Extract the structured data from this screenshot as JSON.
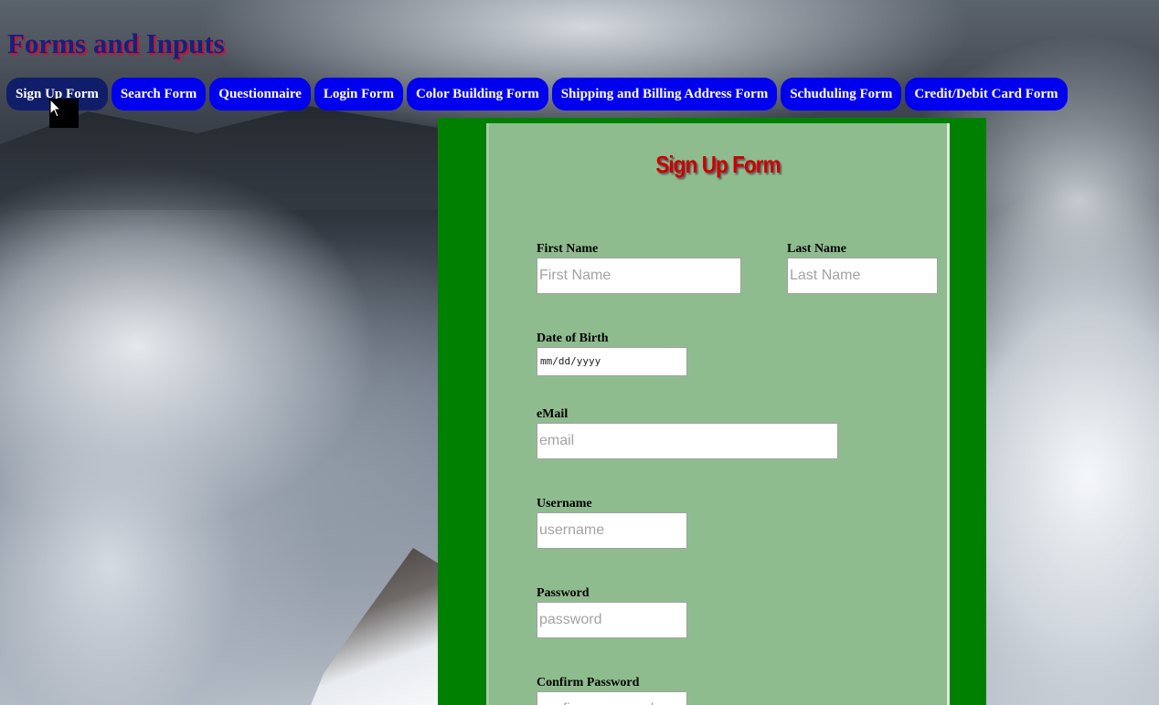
{
  "site": {
    "title": "Forms and Inputs"
  },
  "nav": {
    "items": [
      {
        "label": "Sign Up Form",
        "active": true
      },
      {
        "label": "Search Form"
      },
      {
        "label": "Questionnaire"
      },
      {
        "label": "Login Form"
      },
      {
        "label": "Color Building Form"
      },
      {
        "label": "Shipping and Billing Address Form"
      },
      {
        "label": "Schuduling Form"
      },
      {
        "label": "Credit/Debit Card Form"
      }
    ]
  },
  "form": {
    "title": "Sign Up Form",
    "first_name": {
      "label": "First Name",
      "placeholder": "First Name",
      "value": ""
    },
    "last_name": {
      "label": "Last Name",
      "placeholder": "Last Name",
      "value": ""
    },
    "dob": {
      "label": "Date of Birth",
      "display": "mm/dd/yyyy"
    },
    "email": {
      "label": "eMail",
      "placeholder": "email",
      "value": ""
    },
    "username": {
      "label": "Username",
      "placeholder": "username",
      "value": ""
    },
    "password": {
      "label": "Password",
      "placeholder": "password",
      "value": ""
    },
    "confirm_password": {
      "label": "Confirm Password",
      "placeholder": "confirm password",
      "value": ""
    }
  },
  "colors": {
    "nav_button": "#0000ee",
    "nav_button_active": "#101e6a",
    "form_frame": "#008000",
    "form_panel": "#8fbc8f",
    "form_title": "#cc0000",
    "site_title": "#1a1f7a"
  },
  "icons": {
    "cursor": "mouse-pointer-icon"
  }
}
